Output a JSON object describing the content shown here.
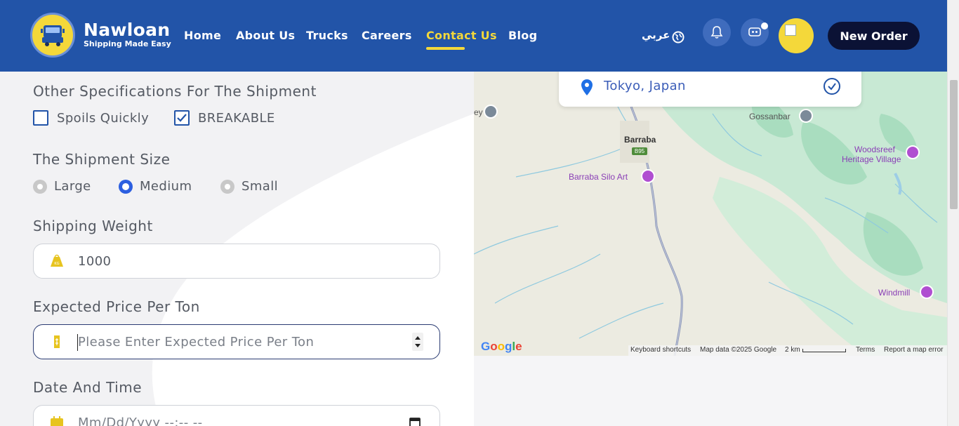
{
  "header": {
    "brand_name": "Nawloan",
    "brand_tagline": "Shipping Made Easy",
    "nav": [
      {
        "label": "Home"
      },
      {
        "label": "About Us"
      },
      {
        "label": "Trucks"
      },
      {
        "label": "Careers"
      },
      {
        "label": "Contact Us",
        "active": true
      },
      {
        "label": "Blog"
      }
    ],
    "language_label": "عربي",
    "new_order_label": "New Order"
  },
  "form": {
    "other_specs_title": "Other Specifications For The Shipment",
    "checkboxes": [
      {
        "label": "Spoils Quickly",
        "checked": false
      },
      {
        "label": "BREAKABLE",
        "checked": true
      }
    ],
    "size_title": "The Shipment Size",
    "sizes": [
      {
        "label": "Large",
        "selected": false
      },
      {
        "label": "Medium",
        "selected": true
      },
      {
        "label": "Small",
        "selected": false
      }
    ],
    "weight_title": "Shipping Weight",
    "weight_value": "1000",
    "weight_icon_text": "KG",
    "price_title": "Expected Price Per Ton",
    "price_placeholder": "Please Enter Expected Price Per Ton",
    "date_title": "Date And Time",
    "date_placeholder": "Mm/Dd/Yyyy --:-- --"
  },
  "map": {
    "location": "Tokyo, Japan",
    "labels": {
      "town": "Barraba",
      "road": "B95",
      "silo": "Barraba Silo Art",
      "gossanbar": "Gossanbar",
      "woodsreef_1": "Woodsreef",
      "woodsreef_2": "Heritage Village",
      "windmill": "Windmill",
      "edge": "ey"
    },
    "footer": {
      "shortcuts": "Keyboard shortcuts",
      "data": "Map data ©2025 Google",
      "scale": "2 km",
      "terms": "Terms",
      "report": "Report a map error"
    },
    "google_logo": "Google"
  },
  "colors": {
    "header_bg": "#2254a8",
    "accent_yellow": "#f4d83a",
    "new_order_bg": "#0b1235",
    "radio_selected": "#2c5fe0"
  }
}
